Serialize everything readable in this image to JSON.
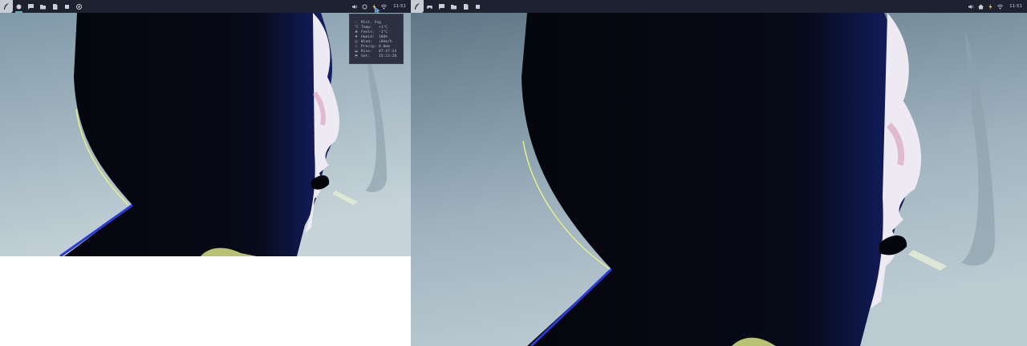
{
  "colors": {
    "bar_bg": "#1e2230",
    "accent": "#4fb8b0",
    "icon": "#c9ced8",
    "launcher_bg": "#c7ccd6",
    "panel_bg": "#2b3140",
    "sky_top": "#7f98a8",
    "sky_bottom": "#c6d4d9",
    "silhouette": "#05060c",
    "face": "#eeeaf4",
    "outline_blue": "#2b3bd6",
    "outline_yellow": "#e6f08a"
  },
  "left_screen": {
    "workspaces": [
      {
        "icon": "circle-icon",
        "active": true
      },
      {
        "icon": "chat-icon",
        "active": false
      },
      {
        "icon": "folder-icon",
        "active": false
      },
      {
        "icon": "file-icon",
        "active": false
      },
      {
        "icon": "square-icon",
        "active": false
      },
      {
        "icon": "target-icon",
        "active": false
      }
    ],
    "tray": {
      "icons": [
        "volume-icon",
        "weather-icon",
        "battery-charging-icon",
        "wifi-icon"
      ],
      "time": "11:51"
    },
    "weather_popup": {
      "rows": [
        {
          "icon": "◌",
          "label": "Mist, Fog",
          "value": ""
        },
        {
          "icon": "℃",
          "label": "Temp:",
          "value": "+1°C"
        },
        {
          "icon": "♣",
          "label": "Feels:",
          "value": "-1°C"
        },
        {
          "icon": "♦",
          "label": "Humid:",
          "value": "100%"
        },
        {
          "icon": "◎",
          "label": "Wind:",
          "value": "↓8km/h"
        },
        {
          "icon": "◇",
          "label": "Precip:",
          "value": "0.0mm"
        },
        {
          "icon": "◒",
          "label": "Rise:",
          "value": "07:47:24"
        },
        {
          "icon": "◓",
          "label": "Set:",
          "value": "15:23:28"
        }
      ]
    }
  },
  "right_screen": {
    "workspaces": [
      {
        "icon": "gamepad-icon",
        "active": false
      },
      {
        "icon": "chat-icon",
        "active": false
      },
      {
        "icon": "folder-icon",
        "active": false
      },
      {
        "icon": "file-icon",
        "active": false
      },
      {
        "icon": "square-icon",
        "active": false
      }
    ],
    "tray": {
      "icons": [
        "volume-icon",
        "home-icon",
        "battery-charging-icon",
        "wifi-icon"
      ],
      "time": "11:51"
    }
  }
}
